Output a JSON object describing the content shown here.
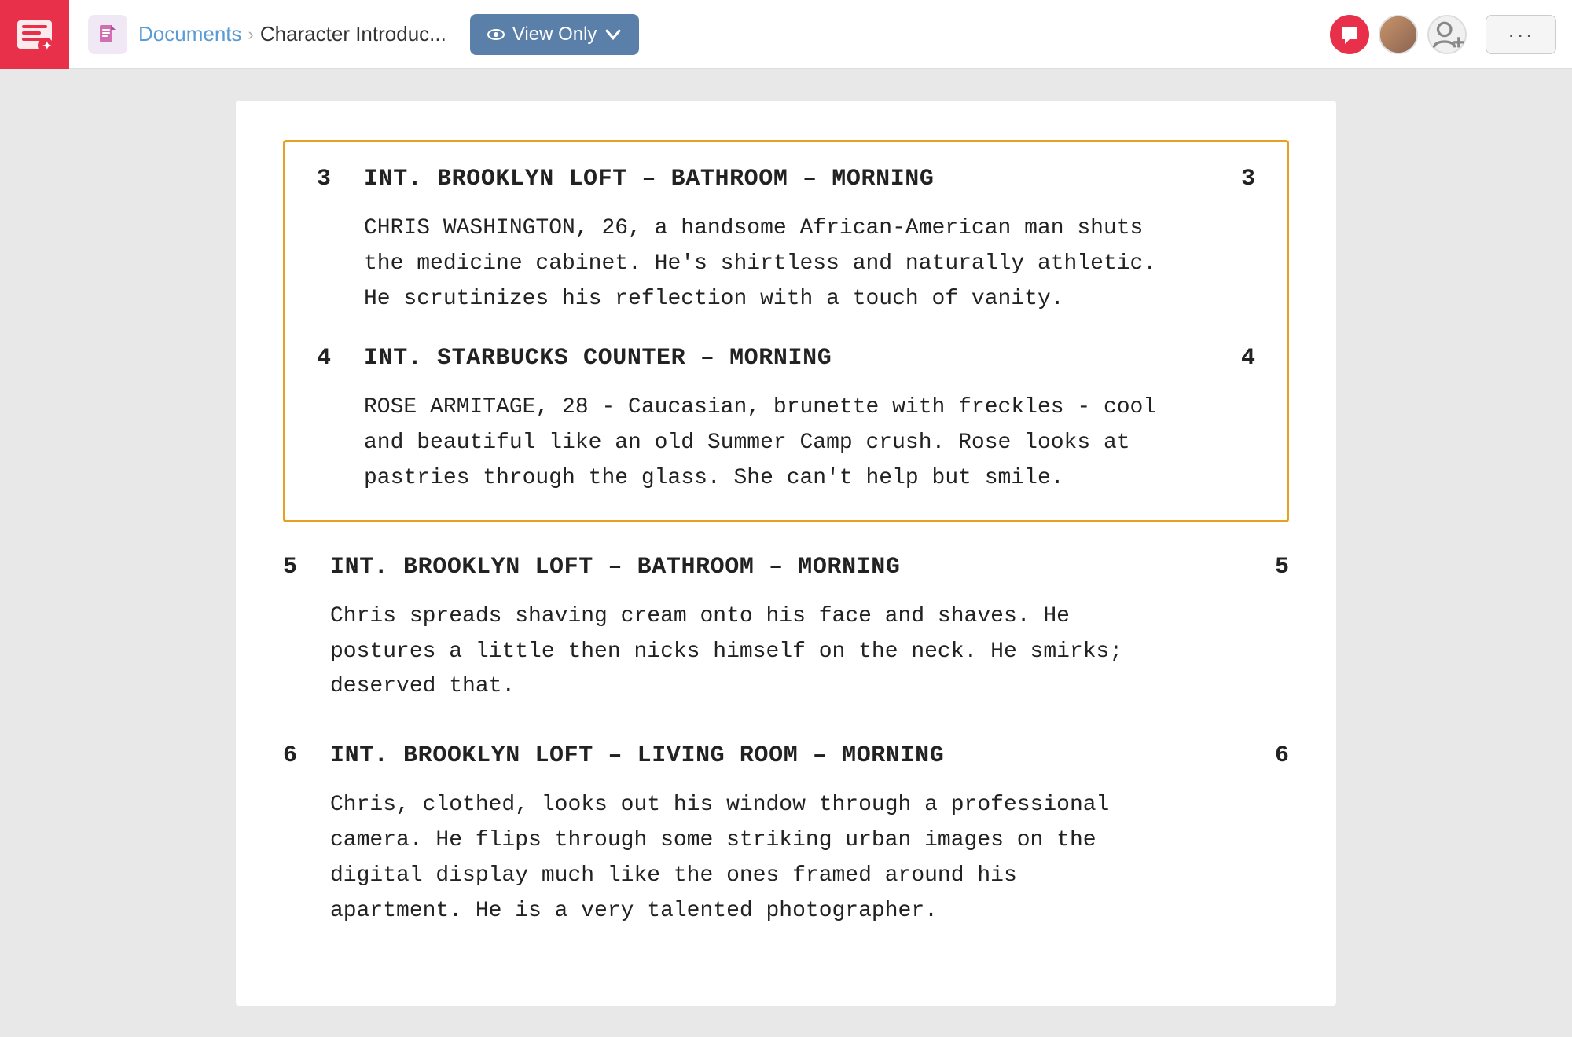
{
  "app": {
    "logo_alt": "WriterDuet",
    "nav_icon_alt": "Document icon"
  },
  "header": {
    "breadcrumb_documents": "Documents",
    "breadcrumb_separator": "›",
    "breadcrumb_current": "Character Introduc...",
    "view_only_label": "View Only",
    "more_dots": "···"
  },
  "scenes": [
    {
      "id": "scene-3",
      "highlighted": true,
      "number_left": "3",
      "heading": "INT. BROOKLYN LOFT – BATHROOM – MORNING",
      "number_right": "3",
      "action": "CHRIS WASHINGTON, 26, a handsome African-American man shuts\nthe medicine cabinet. He's shirtless and naturally athletic.\nHe scrutinizes his reflection with a touch of vanity."
    },
    {
      "id": "scene-4",
      "highlighted": true,
      "number_left": "4",
      "heading": "INT. STARBUCKS COUNTER – MORNING",
      "number_right": "4",
      "action": "ROSE ARMITAGE, 28 - Caucasian, brunette with freckles - cool\nand beautiful like an old Summer Camp crush. Rose looks at\npastries through the glass. She can't help but smile."
    },
    {
      "id": "scene-5",
      "highlighted": false,
      "number_left": "5",
      "heading": "INT. BROOKLYN LOFT – BATHROOM – MORNING",
      "number_right": "5",
      "action": "Chris spreads shaving cream onto his face and shaves. He\npostures a little then nicks himself on the neck. He smirks;\ndeserved that."
    },
    {
      "id": "scene-6",
      "highlighted": false,
      "number_left": "6",
      "heading": "INT. BROOKLYN LOFT – LIVING ROOM – MORNING",
      "number_right": "6",
      "action": "Chris, clothed, looks out his window through a professional\ncamera. He flips through some striking urban images on the\ndigital display much like the ones framed around his\napartment. He is a very talented photographer."
    }
  ],
  "colors": {
    "accent_red": "#e8304a",
    "accent_orange": "#e8a020",
    "accent_blue": "#5a7fa8",
    "link_blue": "#5b9bd5",
    "text_dark": "#222222",
    "bg_gray": "#e8e8e8"
  }
}
